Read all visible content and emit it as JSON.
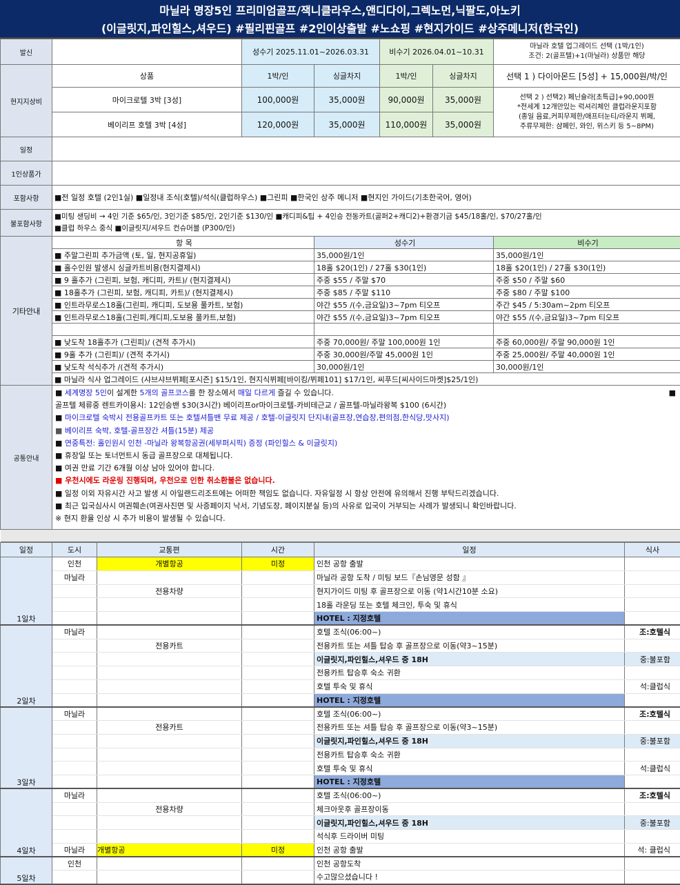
{
  "header": {
    "line1": "마닐라 명장5인 프리미엄골프/잭니클라우스,앤디다이,그렉노먼,닉팔도,아노키",
    "line2": "(이글릿지,파인힐스,셔우드)  #필리핀골프 #2인이상출발 #노쇼핑 #현지가이드 #상주메니저(한국인)"
  },
  "price": {
    "label_sender": "발신",
    "label_local": "현지지상비",
    "peak": "성수기 2025.11.01~2026.03.31",
    "off": "비수기 2026.04.01~10.31",
    "upgrade1": "마닐라 호텔 업그레이드 선택 (1박/1인)",
    "upgrade2": "조건: 2(골프텔)+1(마닐라) 상품만 해당",
    "col_product": "상품",
    "col_night": "1박/인",
    "col_single": "싱글차지",
    "option1": "선택 1 ) 다이아몬드 [5성] + 15,000원/박/인",
    "option2": [
      "선택 2 ) 선택2) 페닌슐라[초특급]+90,000원",
      "*전세계 12개만있는 럭셔리체인 클럽라운지포함",
      "(종일 음료,커피무제한/애프터눈티/라운지 뷔페,",
      "주류무제한: 샴페인, 와인, 위스키 등 5~8PM)"
    ],
    "rows": [
      {
        "product": "마이크로텔 3박 [3성]",
        "peak_night": "100,000원",
        "peak_single": "35,000원",
        "off_night": "90,000원",
        "off_single": "35,000원"
      },
      {
        "product": "베이리프 호텔 3박 [4성]",
        "peak_night": "120,000원",
        "peak_single": "35,000원",
        "off_night": "110,000원",
        "off_single": "35,000원"
      }
    ]
  },
  "labels": {
    "schedule": "일정",
    "per_person": "1인상품가",
    "included": "포함사항",
    "excluded": "불포함사항",
    "other": "기타안내",
    "common": "공통안내"
  },
  "included": "■전 일정 호텔 (2인1실) ■일정내 조식(호텔)/석식(클럽하우스) ■그린피 ■한국인 상주 메니저 ■현지인 가이드(기초한국어, 영어)",
  "excluded": [
    "■미팅 샌딩비 → 4인 기준 $65/인, 3인기준 $85/인, 2인기준 $130/인 ■캐디피&팁 + 4인승 전동카트(골퍼2+캐디2)+환경기금  $45/18홀/인, $70/27홀/인",
    "■클럽 하우스 중식 ■이글릿지/셔우드 컨슈머블 (P300/인)"
  ],
  "other": {
    "head": {
      "item": "항 목",
      "peak": "성수기",
      "off": "비수기"
    },
    "rows1": [
      {
        "item": "■  주말그린피  추가금액  (토, 일, 현지공휴일)",
        "peak": "35,000원/1인",
        "off": "35,000원/1인"
      },
      {
        "item": "■  홀수인원  발생시  싱글카트비용(현지결제시)",
        "peak": "18홀 $20(1인) / 27홀 $30(1인)",
        "off": "18홀 $20(1인) / 27홀 $30(1인)"
      },
      {
        "item": "■  9  홀추가  (그린피, 보험, 캐디피, 카트)/  (현지결제시)",
        "peak": "주중 $55 / 주말 $70",
        "off": "주중 $50 / 주말 $60"
      },
      {
        "item": "■  18홀추가  (그린피, 보험, 캐디피, 카트)/  (현지결제시)",
        "peak": "주중 $85 / 주말 $110",
        "off": "주중 $80 / 주말 $100"
      },
      {
        "item": "■  인트라무로스18홀(그린피, 캐디피, 도보용  풀카트, 보험)",
        "peak": "야간 $55 /(수,금요일)3~7pm 티오프",
        "off": "주간  $45  /  5:30am~2pm  티오프"
      },
      {
        "item": "■ 인트라무로스18홀(그린피,캐디피,도보용 풀카트,보험)",
        "peak": "야간 $55 /(수,금요일)3~7pm 티오프",
        "off": "야간 $55 /(수,금요일)3~7pm 티오프"
      }
    ],
    "rows2": [
      {
        "item": "■  낮도착 18홀추가 (그린피)/ (견적 추가시)",
        "peak": "주중 70,000원/ 주말  100,000원 1인",
        "off": "주중 60,000원/ 주말 90,000원 1인"
      },
      {
        "item": "■  9홀 추가 (그린피)/ (견적 추가시)",
        "peak": "주중 30,000원/주말 45,000원 1인",
        "off": "주중 25,000원/ 주말 40,000원 1인"
      },
      {
        "item": "■  낮도착 석식추가 /(견적 추가시)",
        "peak": "30,000원/1인",
        "off": "30,000원/1인"
      }
    ],
    "upgrade": "■ 마닐라 식사 업그레이드 (샤브샤브뷔페[포시즌] $15/1인, 현지식뷔페[바이킹/뷔페101] $17/1인, 씨푸드[씨사이드마켓]$25/1인)"
  },
  "common": {
    "l1": {
      "a": "■ ",
      "b": "세계명장 5인",
      "c": "이 설계한 ",
      "d": "5개의 골프코스",
      "e": "를 한 장소에서 ",
      "f": "매일 다르게",
      "g": " 즐길 수 있습니다."
    },
    "l2": "골프텔 체류중 렌트카이용시: 12인승밴 $30(3시간) 베이리프or마이크로텔-카비테근교 / 골프텔-마닐라왕복 $100 (6시간)",
    "l3": "마이크로텔 숙박시 전용골프카트 또는 호텔셔틀밴 무료 제공 / 호텔-이글릿지 단지내(골프장,연습장,편의점,한식당,맛사지)",
    "l4": "베이리프 숙박, 호텔-골프장간 셔틀(15분) 제공",
    "l5": "연중특전: 홀인원시 인천 -마닐라 왕복항공권(세부퍼시픽) 증정 (파인힐스 & 이글릿지)",
    "l6": "■ 휴장일 또는 토너먼트시 동급 골프장으로 대체됩니다.",
    "l7": "■ 여권 만료 기간 6개월 이상 남아 있어야 합니다.",
    "l8": "■ 우천시에도 라운링 진행되며, 우천으로 인한 취소환불은 없습니다.",
    "l9": "■ 일정 이외 자유시간 사고 발생 시 아일랜드리조트에는 어떠한 책임도 없습니다. 자유일정 시 항상 안전에 유의해서 진행 부탁드리겠습니다.",
    "l10": "■ 최근 입국심사시 여권훼손(여권사진면 및 사증페이지 낙서, 기념도장, 페이지분실 등)의 사유로 입국이 거부되는 사례가 발생되니 확인바랍니다.",
    "l11": "※ 현지 환율 인상 시 추가 비용이 발생될 수 있습니다.",
    "bullet": "■"
  },
  "itinerary": {
    "head": [
      "일정",
      "도시",
      "교통편",
      "시간",
      "일정",
      "식사"
    ],
    "days": [
      {
        "label": "1일차",
        "rows": [
          {
            "city": "인천",
            "trans": "개별항공",
            "time": "미정",
            "sched": "인천 공항 출발",
            "meal": "",
            "hl": "yel"
          },
          {
            "city": "마닐라",
            "trans": "",
            "time": "",
            "sched": "마닐라 공항 도착 / 미팅 보드『손님영문 성함 』",
            "meal": ""
          },
          {
            "city": "",
            "trans": "전용차량",
            "time": "",
            "sched": "현지가이드 미팅 후 골프장으로 이동 (약1시간10분 소요)",
            "meal": ""
          },
          {
            "city": "",
            "trans": "",
            "time": "",
            "sched": "18홀 라운딩 또는 호텔 체크인, 투숙 및 휴식",
            "meal": ""
          },
          {
            "city": "",
            "trans": "",
            "time": "",
            "sched": "HOTEL : 지정호텔",
            "meal": "",
            "type": "hotel"
          }
        ]
      },
      {
        "label": "2일차",
        "rows": [
          {
            "city": "마닐라",
            "trans": "",
            "time": "",
            "sched": "호텔 조식(06:00~)",
            "meal": "조:호텔식",
            "mb": true
          },
          {
            "city": "",
            "trans": "전용카트",
            "time": "",
            "sched": "전용카트 또는 셔틀 탑승 후 골프장으로 이동(약3~15분)",
            "meal": ""
          },
          {
            "city": "",
            "trans": "",
            "time": "",
            "sched": "이글릿지,파인힐스,셔우드 중 18H",
            "meal": "중:불포함",
            "type": "golf"
          },
          {
            "city": "",
            "trans": "",
            "time": "",
            "sched": "전용카트 탑승후 숙소 귀환",
            "meal": ""
          },
          {
            "city": "",
            "trans": "",
            "time": "",
            "sched": "호텔 투숙 및 휴식",
            "meal": "석:클럽식"
          },
          {
            "city": "",
            "trans": "",
            "time": "",
            "sched": "HOTEL : 지정호텔",
            "meal": "",
            "type": "hotel"
          }
        ]
      },
      {
        "label": "3일차",
        "rows": [
          {
            "city": "마닐라",
            "trans": "",
            "time": "",
            "sched": "호텔 조식(06:00~)",
            "meal": "조:호텔식",
            "mb": true
          },
          {
            "city": "",
            "trans": "전용카트",
            "time": "",
            "sched": "전용카트 또는 셔틀 탑승 후 골프장으로 이동(약3~15분)",
            "meal": ""
          },
          {
            "city": "",
            "trans": "",
            "time": "",
            "sched": "이글릿지,파인힐스,셔우드 중 18H",
            "meal": "중:불포함",
            "type": "golf"
          },
          {
            "city": "",
            "trans": "",
            "time": "",
            "sched": "전용카트 탑승후 숙소 귀환",
            "meal": ""
          },
          {
            "city": "",
            "trans": "",
            "time": "",
            "sched": "호텔 투숙 및 휴식",
            "meal": "석:클럽식"
          },
          {
            "city": "",
            "trans": "",
            "time": "",
            "sched": "HOTEL : 지정호텔",
            "meal": "",
            "type": "hotel"
          }
        ]
      },
      {
        "label": "4일차",
        "rows": [
          {
            "city": "마닐라",
            "trans": "",
            "time": "",
            "sched": "호텔 조식(06:00~)",
            "meal": "조:호텔식",
            "mb": true
          },
          {
            "city": "",
            "trans": "전용차량",
            "time": "",
            "sched": "체크아웃후 골프장이동",
            "meal": ""
          },
          {
            "city": "",
            "trans": "",
            "time": "",
            "sched": "이글릿지,파인힐스,셔우드 중 18H",
            "meal": "중:불포함",
            "type": "golf"
          },
          {
            "city": "",
            "trans": "",
            "time": "",
            "sched": "석식후 드라이버 미팅",
            "meal": ""
          },
          {
            "city": "마닐라",
            "trans": "개별항공",
            "time": "미정",
            "sched": "인천 공항 출발",
            "meal": "석: 클럽식",
            "hl": "yel",
            "left": true
          }
        ]
      },
      {
        "label": "5일차",
        "rows": [
          {
            "city": "인천",
            "trans": "",
            "time": "",
            "sched": "인천 공항도착",
            "meal": ""
          },
          {
            "city": "",
            "trans": "",
            "time": "",
            "sched": "수고많으셨습니다 !",
            "meal": ""
          }
        ]
      }
    ]
  },
  "colors": {
    "navy": "#0c2a67",
    "peak": "#d6ecf8",
    "off": "#e0f0d8",
    "hotel": "#8eaadb",
    "highlight": "#ffff00"
  }
}
